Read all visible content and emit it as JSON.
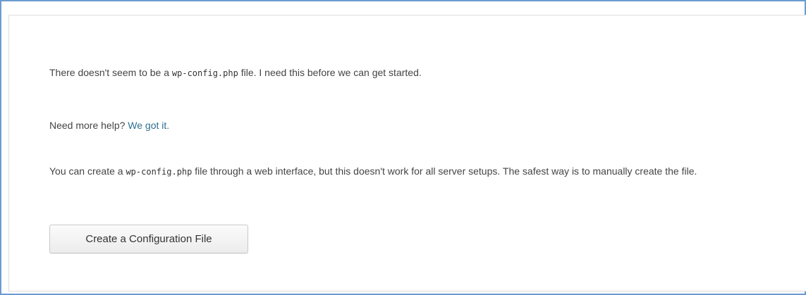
{
  "message": {
    "missing_prefix": "There doesn't seem to be a ",
    "config_file": "wp-config.php",
    "missing_suffix": " file. I need this before we can get started."
  },
  "help": {
    "prefix": "Need more help? ",
    "link_label": "We got it."
  },
  "instructions": {
    "prefix": "You can create a ",
    "config_file": "wp-config.php",
    "suffix": " file through a web interface, but this doesn't work for all server setups. The safest way is to manually create the file."
  },
  "actions": {
    "create_button_label": "Create a Configuration File"
  },
  "colors": {
    "link": "#2f6f8f",
    "text": "#444444",
    "frame_border": "#6b9bd1"
  }
}
